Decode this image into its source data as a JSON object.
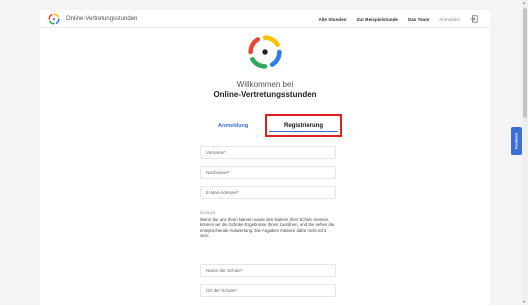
{
  "header": {
    "brand_name": "Online-Vertretungsstunden",
    "nav": {
      "all_hours": "Alle Stunden",
      "sample_lesson": "Zur Beispielstunde",
      "team": "Das Team",
      "login": "Anmelden"
    }
  },
  "welcome": {
    "line1": "Willkommen bei",
    "line2": "Online-Vertretungsstunden"
  },
  "tabs": {
    "login": "Anmeldung",
    "register": "Registrierung"
  },
  "form": {
    "first_name_placeholder": "Vorname*",
    "last_name_placeholder": "Nachname*",
    "email_placeholder": "E-Mail-Adresse*",
    "school_section_label": "SCHULE",
    "school_info": "Wenn Sie uns Ihren Namen sowie den Namen Ihrer Schule nennen, können wir die Schüler-Ergebnisse Ihnen zuordnen, und Sie sehen die entsprechende Auswertung. Die Angaben müssen dafür nicht echt sein.",
    "school_name_placeholder": "Name der Schule*",
    "school_city_placeholder": "Ort der Schule*"
  },
  "feedback": {
    "label": "Feedback"
  },
  "colors": {
    "accent": "#3a6ed8",
    "highlight": "#e02020",
    "logo_yellow": "#f5c400",
    "logo_red": "#e8453c",
    "logo_green": "#2eaa5c",
    "logo_blue": "#2f7bea"
  }
}
